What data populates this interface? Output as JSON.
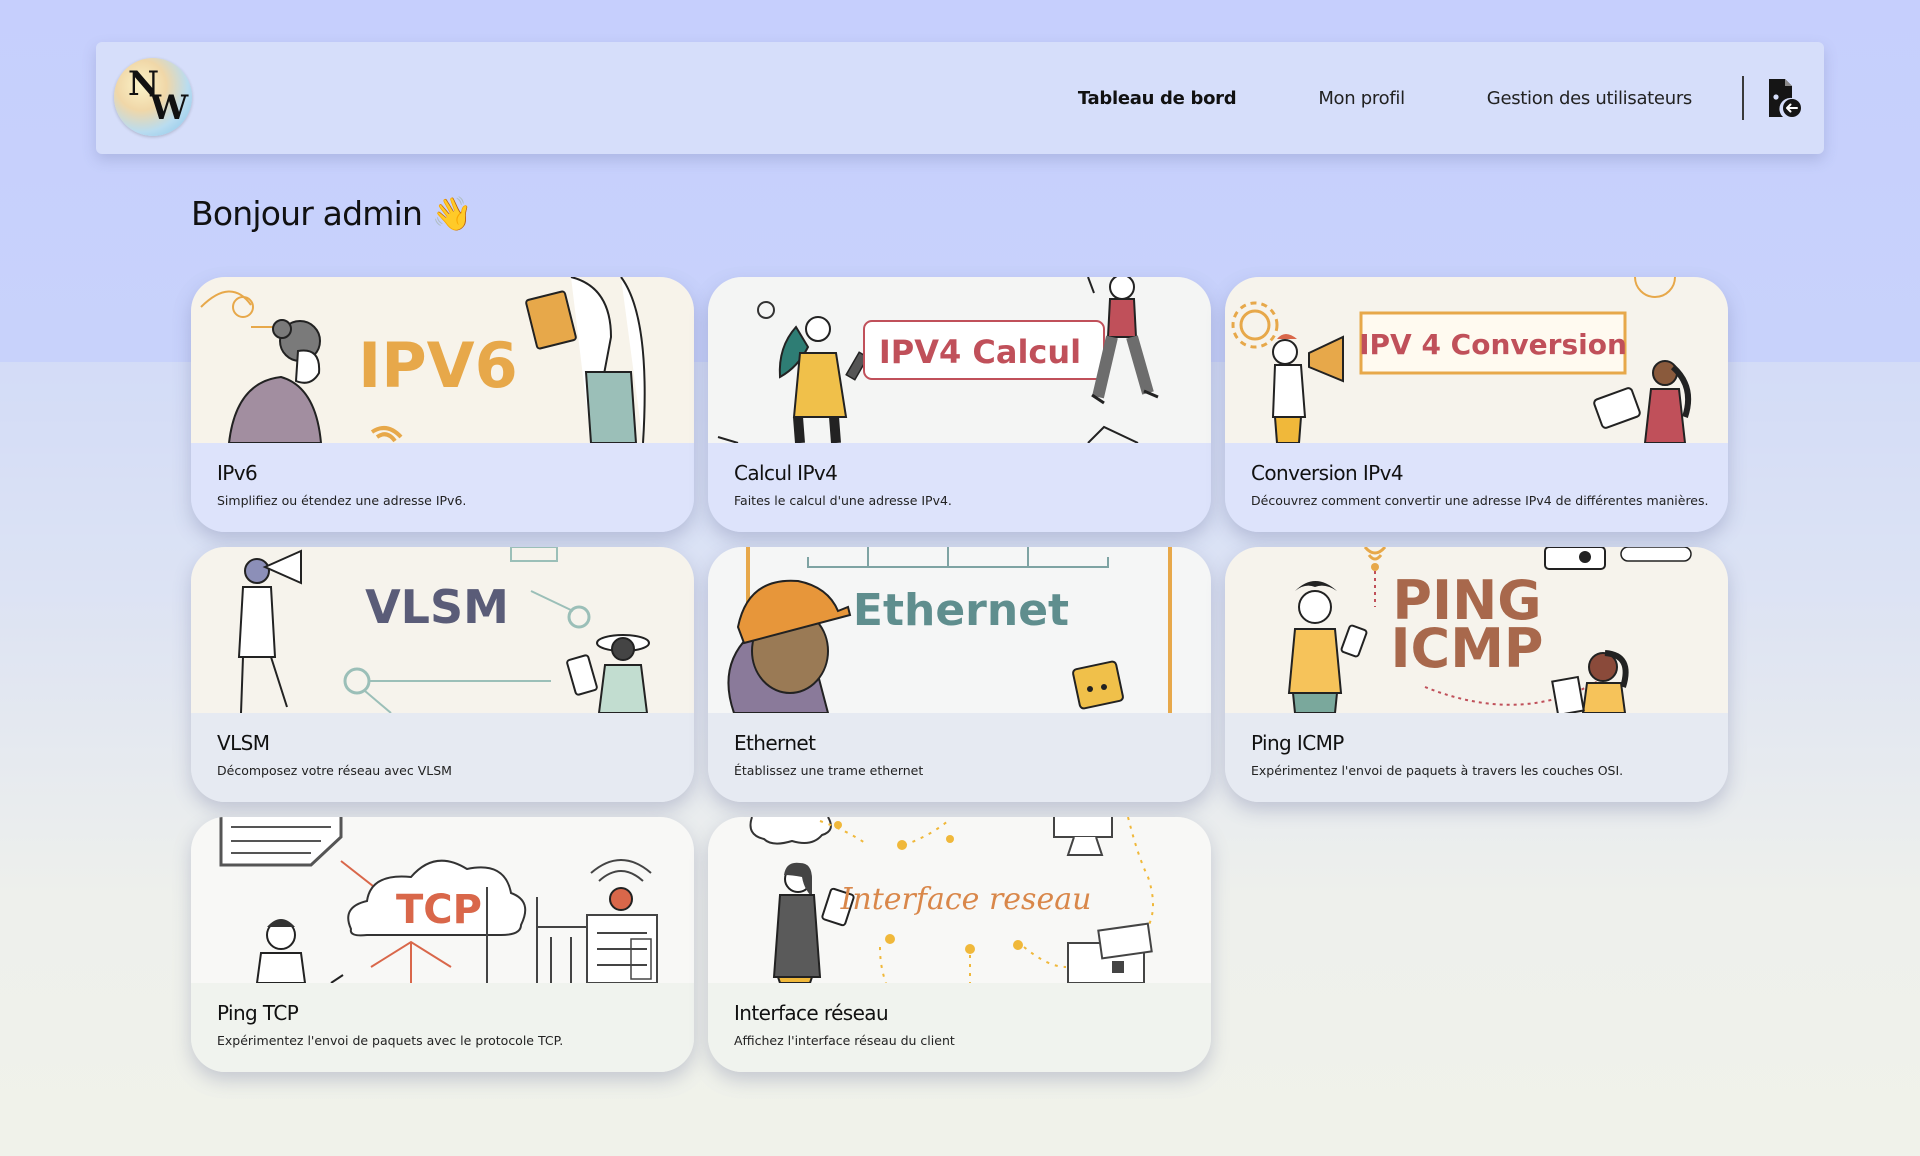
{
  "nav": {
    "logo_letters": [
      "N",
      "W"
    ],
    "links": [
      "Tableau de bord",
      "Mon profil",
      "Gestion des utilisateurs"
    ],
    "active": "Tableau de bord",
    "logout_icon": "logout-icon"
  },
  "greeting": {
    "text": "Bonjour admin",
    "emoji": "👋"
  },
  "cards": [
    {
      "title": "IPv6",
      "description": "Simplifiez ou étendez une adresse IPv6.",
      "banner": "IPV6"
    },
    {
      "title": "Calcul IPv4",
      "description": "Faites le calcul d'une adresse IPv4.",
      "banner": "IPV4 Calcul"
    },
    {
      "title": "Conversion IPv4",
      "description": "Découvrez comment convertir une adresse IPv4 de différentes manières.",
      "banner": "IPV 4 Conversion"
    },
    {
      "title": "VLSM",
      "description": "Décomposez votre réseau avec VLSM",
      "banner": "VLSM"
    },
    {
      "title": "Ethernet",
      "description": "Établissez une trame ethernet",
      "banner": "Ethernet"
    },
    {
      "title": "Ping ICMP",
      "description": "Expérimentez l'envoi de paquets à travers les couches OSI.",
      "banner_line1": "PING",
      "banner_line2": "ICMP"
    },
    {
      "title": "Ping TCP",
      "description": "Expérimentez l'envoi de paquets avec le protocole TCP.",
      "banner": "TCP"
    },
    {
      "title": "Interface réseau",
      "description": "Affichez l'interface réseau du client",
      "banner": "Interface reseau"
    }
  ],
  "colors": {
    "page_top": "#c6cffd",
    "page_bottom": "#f0f2ea",
    "navbar": "#d6defa",
    "ipv6_orange": "#e7a84a",
    "ipv4_red": "#c0505a",
    "vlsm_slate": "#5a5c78",
    "ethernet_teal": "#5f8e8e",
    "ping_brown": "#a8684c",
    "tcp_orange": "#d9674a",
    "interface_orange": "#d9874a"
  }
}
